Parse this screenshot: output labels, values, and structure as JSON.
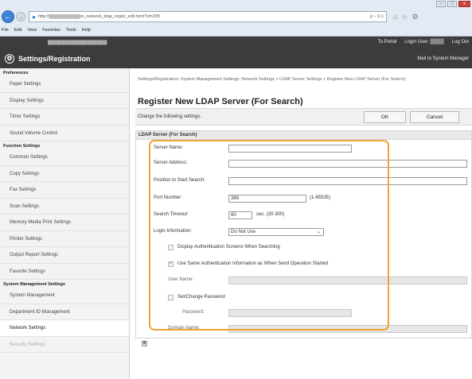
{
  "browser": {
    "address_url": "http://",
    "address_url_tail": "m_network_ldap_regist_edit.html?id=235",
    "address_tools": "ρ - ≡ c",
    "menu": [
      "File",
      "Edit",
      "View",
      "Favorites",
      "Tools",
      "Help"
    ],
    "window_buttons": [
      "–",
      "□",
      "x"
    ]
  },
  "header": {
    "title": "Settings/Registration",
    "links": {
      "portal": "To Portal",
      "login_user": "Login User:",
      "logout": "Log Out",
      "mail_admin": "Mail to System Manager"
    }
  },
  "sidebar": {
    "sections": [
      {
        "heading": "Preferences",
        "items": [
          "Paper Settings",
          "Display Settings",
          "Timer Settings",
          "Sound Volume Control"
        ]
      },
      {
        "heading": "Function Settings",
        "items": [
          "Common Settings",
          "Copy Settings",
          "Fax Settings",
          "Scan Settings",
          "Memory Media Print Settings",
          "Printer Settings",
          "Output Report Settings",
          "Favorite Settings"
        ]
      },
      {
        "heading": "System Management Settings",
        "items": [
          "System Management",
          "Department ID Management",
          "Network Settings",
          "Security Settings"
        ]
      }
    ]
  },
  "main": {
    "breadcrumb": "Settings/Registration: System Management Settings: Network Settings > LDAP Server Settings > Register New LDAP Server (For Search)",
    "page_title": "Register New LDAP Server (For Search)",
    "instruction": "Change the following settings.",
    "ok_label": "OK",
    "cancel_label": "Cancel",
    "panel_title": "LDAP Server (For Search)",
    "fields": {
      "server_name": {
        "label": "Server Name:",
        "value": ""
      },
      "server_address": {
        "label": "Server Address:",
        "value": ""
      },
      "position_start": {
        "label": "Position to Start Search:",
        "value": ""
      },
      "port_number": {
        "label": "Port Number:",
        "value": "389",
        "hint": "(1-65535)"
      },
      "search_timeout": {
        "label": "Search Timeout:",
        "value": "60",
        "hint": "sec. (30-300)"
      },
      "login_information": {
        "label": "Login Information:",
        "value": "Do Not Use"
      },
      "display_auth": {
        "label": "Display Authentication Screens When Searching",
        "checked": false
      },
      "use_same_auth": {
        "label": "Use Same Authentication Information as When Send Operation Started",
        "checked": true
      },
      "user_name": {
        "label": "User Name:",
        "value": ""
      },
      "set_change_password": {
        "label": "Set/Change Password",
        "checked": false
      },
      "password": {
        "label": "Password:",
        "value": ""
      },
      "domain_name": {
        "label": "Domain Name:",
        "value": ""
      }
    },
    "bottom_icon": "≣"
  },
  "colors": {
    "header_bg": "#3c3c3c",
    "highlight_border": "#f0a23a",
    "back_button": "#3b83d6"
  }
}
